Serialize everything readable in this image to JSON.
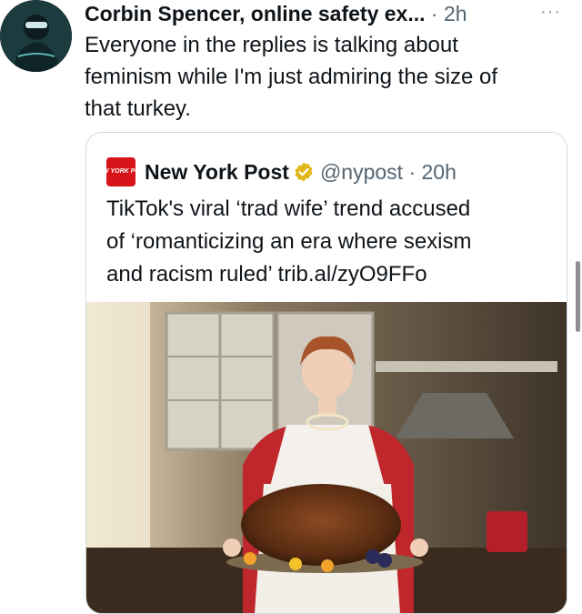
{
  "tweet": {
    "author_name": "Corbin Spencer, online safety ex...",
    "time": "· 2h",
    "more_label": "···",
    "text": "Everyone in the replies is talking about\nfeminism while I'm just admiring the size of\nthat turkey."
  },
  "quote": {
    "logo_text": "NEW YORK POST",
    "author_name": "New York Post",
    "handle_time": "@nypost · 20h",
    "text": "TikTok's viral ‘trad wife’ trend accused\nof ‘romanticizing an era where sexism\nand racism ruled’ trib.al/zyO9FFo"
  },
  "icons": {
    "avatar": "avatar-image",
    "verified": "verified-badge-icon",
    "more": "more-options-icon"
  },
  "colors": {
    "verified_gold": "#e2b719",
    "nypost_red": "#d7141a",
    "secondary_text": "#536471",
    "border": "#cfd9de"
  }
}
